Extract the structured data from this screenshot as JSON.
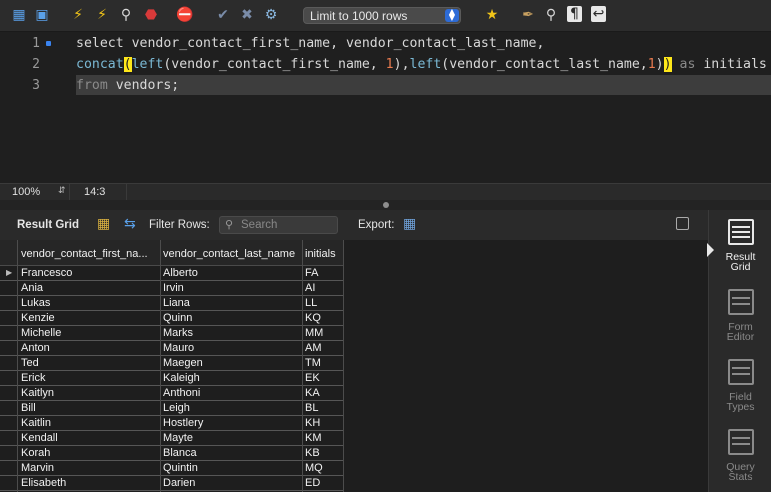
{
  "toolbar": {
    "icons": [
      "open-folder-icon",
      "save-icon",
      "execute-icon",
      "execute-current-icon",
      "explain-icon",
      "stop-icon",
      "toggle-error-icon",
      "commit-icon",
      "rollback-icon",
      "autocommit-icon",
      "beautify-icon",
      "find-icon",
      "invisible-chars-icon",
      "wrap-icon"
    ],
    "limit_label": "Limit to 1000 rows"
  },
  "editor": {
    "line_numbers": [
      "1",
      "2",
      "3"
    ],
    "line1": "select vendor_contact_first_name, vendor_contact_last_name,",
    "line2": {
      "fn1": "concat",
      "par_open": "(",
      "fn2": "left",
      "arg1": "(vendor_contact_first_name, ",
      "n1": "1",
      "mid": "),",
      "fn3": "left",
      "arg2": "(vendor_contact_last_name,",
      "n2": "1",
      "close1": ")",
      "par_close": ")",
      "kw_as": " as",
      "alias": " initials"
    },
    "line3": {
      "kw_from": "from",
      "rest": " vendors;"
    }
  },
  "status": {
    "zoom": "100%",
    "cursor": "14:3"
  },
  "results": {
    "result_grid_label": "Result Grid",
    "filter_rows_label": "Filter Rows:",
    "search_placeholder": "Search",
    "export_label": "Export:",
    "columns": [
      "vendor_contact_first_na...",
      "vendor_contact_last_name",
      "initials"
    ],
    "rows": [
      [
        "Francesco",
        "Alberto",
        "FA"
      ],
      [
        "Ania",
        "Irvin",
        "AI"
      ],
      [
        "Lukas",
        "Liana",
        "LL"
      ],
      [
        "Kenzie",
        "Quinn",
        "KQ"
      ],
      [
        "Michelle",
        "Marks",
        "MM"
      ],
      [
        "Anton",
        "Mauro",
        "AM"
      ],
      [
        "Ted",
        "Maegen",
        "TM"
      ],
      [
        "Erick",
        "Kaleigh",
        "EK"
      ],
      [
        "Kaitlyn",
        "Anthoni",
        "KA"
      ],
      [
        "Bill",
        "Leigh",
        "BL"
      ],
      [
        "Kaitlin",
        "Hostlery",
        "KH"
      ],
      [
        "Kendall",
        "Mayte",
        "KM"
      ],
      [
        "Korah",
        "Blanca",
        "KB"
      ],
      [
        "Marvin",
        "Quintin",
        "MQ"
      ],
      [
        "Elisabeth",
        "Darien",
        "ED"
      ]
    ]
  },
  "sidebar": {
    "items": [
      {
        "label1": "Result",
        "label2": "Grid"
      },
      {
        "label1": "Form",
        "label2": "Editor"
      },
      {
        "label1": "Field",
        "label2": "Types"
      },
      {
        "label1": "Query",
        "label2": "Stats"
      }
    ]
  },
  "colors": {
    "accent_blue": "#2d6bd6",
    "paren_highlight": "#ffe81a",
    "number": "#e87a4f",
    "function": "#7ab8d4"
  }
}
